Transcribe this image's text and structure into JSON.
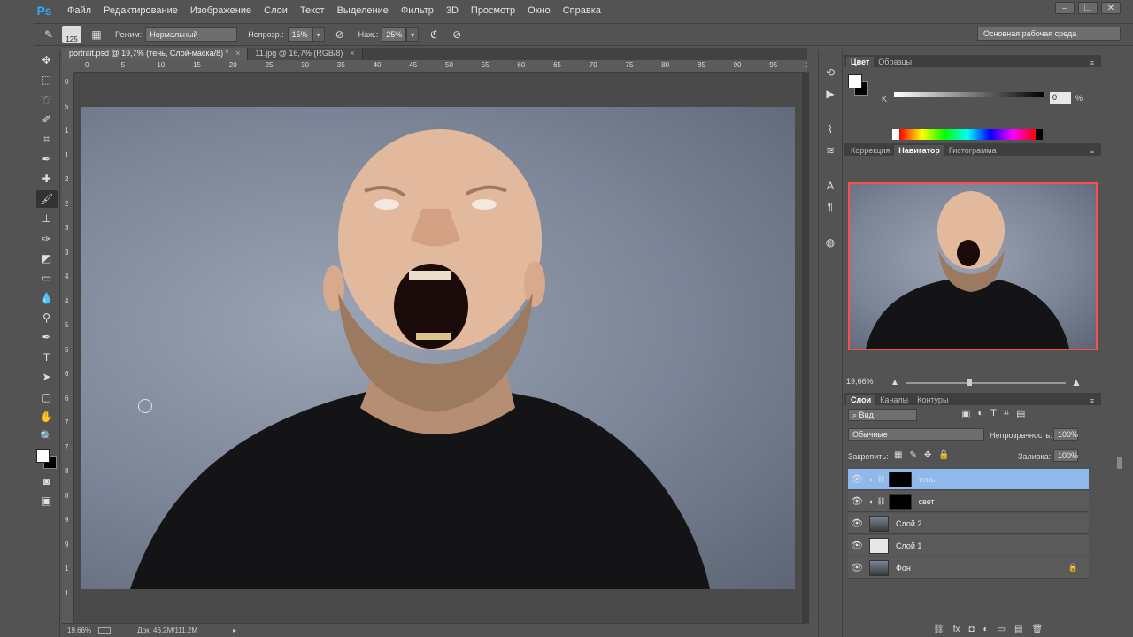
{
  "app": {
    "logo": "Ps"
  },
  "menu": [
    "Файл",
    "Редактирование",
    "Изображение",
    "Слои",
    "Текст",
    "Выделение",
    "Фильтр",
    "3D",
    "Просмотр",
    "Окно",
    "Справка"
  ],
  "options": {
    "brush_size": "125",
    "mode_label": "Режим:",
    "mode_value": "Нормальный",
    "opacity_label": "Непрозр.:",
    "opacity_value": "15%",
    "flow_label": "Наж.:",
    "flow_value": "25%",
    "workspace": "Основная рабочая среда"
  },
  "doc_tabs": [
    {
      "label": "portrait.psd @ 19,7% (тень, Слой-маска/8) *",
      "close": "×"
    },
    {
      "label": "11.jpg @ 16,7% (RGB/8)",
      "close": "×"
    }
  ],
  "ruler_h": [
    "0",
    "5",
    "10",
    "15",
    "20",
    "25",
    "30",
    "35",
    "40",
    "45",
    "50",
    "55",
    "60",
    "65",
    "70",
    "75",
    "80",
    "85",
    "90",
    "95",
    "1"
  ],
  "ruler_v": [
    "0",
    "5",
    "1",
    "1",
    "2",
    "2",
    "3",
    "3",
    "4",
    "4",
    "5",
    "5",
    "6",
    "6",
    "7",
    "7",
    "8",
    "8",
    "9",
    "9",
    "1",
    "1"
  ],
  "status": {
    "zoom": "19,66%",
    "doc": "Док: 46,2M/111,2M"
  },
  "color_panel": {
    "tabs": [
      "Цвет",
      "Образцы"
    ],
    "k_label": "K",
    "k_value": "0",
    "k_unit": "%",
    "colors": {
      "foreground": "#ffffff",
      "background": "#000000"
    }
  },
  "nav_panel": {
    "tabs": [
      "Коррекция",
      "Навигатор",
      "Гистограмма"
    ],
    "zoom": "19,66%"
  },
  "layers_panel": {
    "tabs": [
      "Слои",
      "Каналы",
      "Контуры"
    ],
    "filter": "Вид",
    "blend_mode": "Обычные",
    "opacity_label": "Непрозрачность:",
    "opacity_value": "100%",
    "lock_label": "Закрепить:",
    "fill_label": "Заливка:",
    "fill_value": "100%",
    "layers": [
      {
        "name": "тень",
        "selected": true
      },
      {
        "name": "свет",
        "selected": false
      },
      {
        "name": "Слой 2",
        "selected": false
      },
      {
        "name": "Слой 1",
        "selected": false
      },
      {
        "name": "Фон",
        "selected": false
      }
    ]
  }
}
